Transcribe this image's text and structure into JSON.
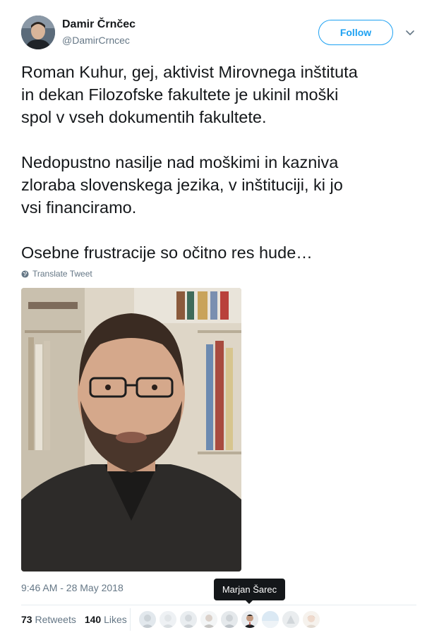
{
  "author": {
    "name": "Damir Črnčec",
    "handle": "@DamirCrncec"
  },
  "actions": {
    "follow_label": "Follow"
  },
  "tweet": {
    "paragraphs": [
      "Roman Kuhur, gej, aktivist Mirovnega inštituta\nin dekan Filozofske fakultete je ukinil moški\nspol v vseh dokumentih fakultete.",
      "Nedopustno nasilje nad moškimi in kazniva\nzloraba slovenskega jezika, v inštituciji, ki jo\nvsi financiramo.",
      "Osebne frustracije so očitno res hude…"
    ],
    "translate_label": "Translate Tweet",
    "timestamp": "9:46 AM - 28 May 2018"
  },
  "stats": {
    "retweets_count": "73",
    "retweets_label": "Retweets",
    "likes_count": "140",
    "likes_label": "Likes"
  },
  "tooltip": {
    "text": "Marjan Šarec"
  },
  "likers": [
    {
      "icon": "avatar-icon"
    },
    {
      "icon": "avatar-icon"
    },
    {
      "icon": "avatar-icon"
    },
    {
      "icon": "avatar-icon"
    },
    {
      "icon": "avatar-icon"
    },
    {
      "icon": "avatar-icon",
      "hovered": true
    },
    {
      "icon": "avatar-icon"
    },
    {
      "icon": "avatar-icon"
    },
    {
      "icon": "avatar-icon"
    }
  ],
  "colors": {
    "accent": "#1da1f2",
    "text": "#14171a",
    "secondary": "#657786"
  }
}
